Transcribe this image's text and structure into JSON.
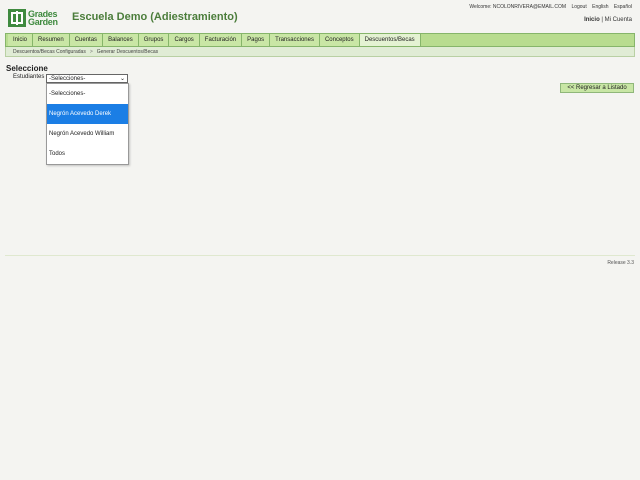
{
  "header": {
    "logo_text": [
      "Grades",
      "Garden"
    ],
    "school_name": "Escuela Demo (Adiestramiento)",
    "welcome": "Welcome: NCOLONRIVERA@EMAIL.COM",
    "links": [
      "Logout",
      "English",
      "Español"
    ],
    "inicio": "Inicio",
    "mi_cuenta": "Mi Cuenta"
  },
  "nav": [
    "Inicio",
    "Resumen",
    "Cuentas",
    "Balances",
    "Grupos",
    "Cargos",
    "Facturación",
    "Pagos",
    "Transacciones",
    "Conceptos",
    "Descuentos/Becas"
  ],
  "subnav": {
    "crumb1": "Descuentos/Becas Configuradas",
    "sep": ">",
    "crumb2": "Generar Descuentos/Becas"
  },
  "form": {
    "heading": "Seleccione",
    "label": "Estudiantes",
    "selected": "-Selecciones-",
    "options": [
      "-Selecciones-",
      "Negrón Acevedo Derek",
      "Negrón Acevedo William",
      "Todos"
    ]
  },
  "back_button": "<< Regresar a Listado",
  "footer": {
    "release": "Release 3.3"
  }
}
